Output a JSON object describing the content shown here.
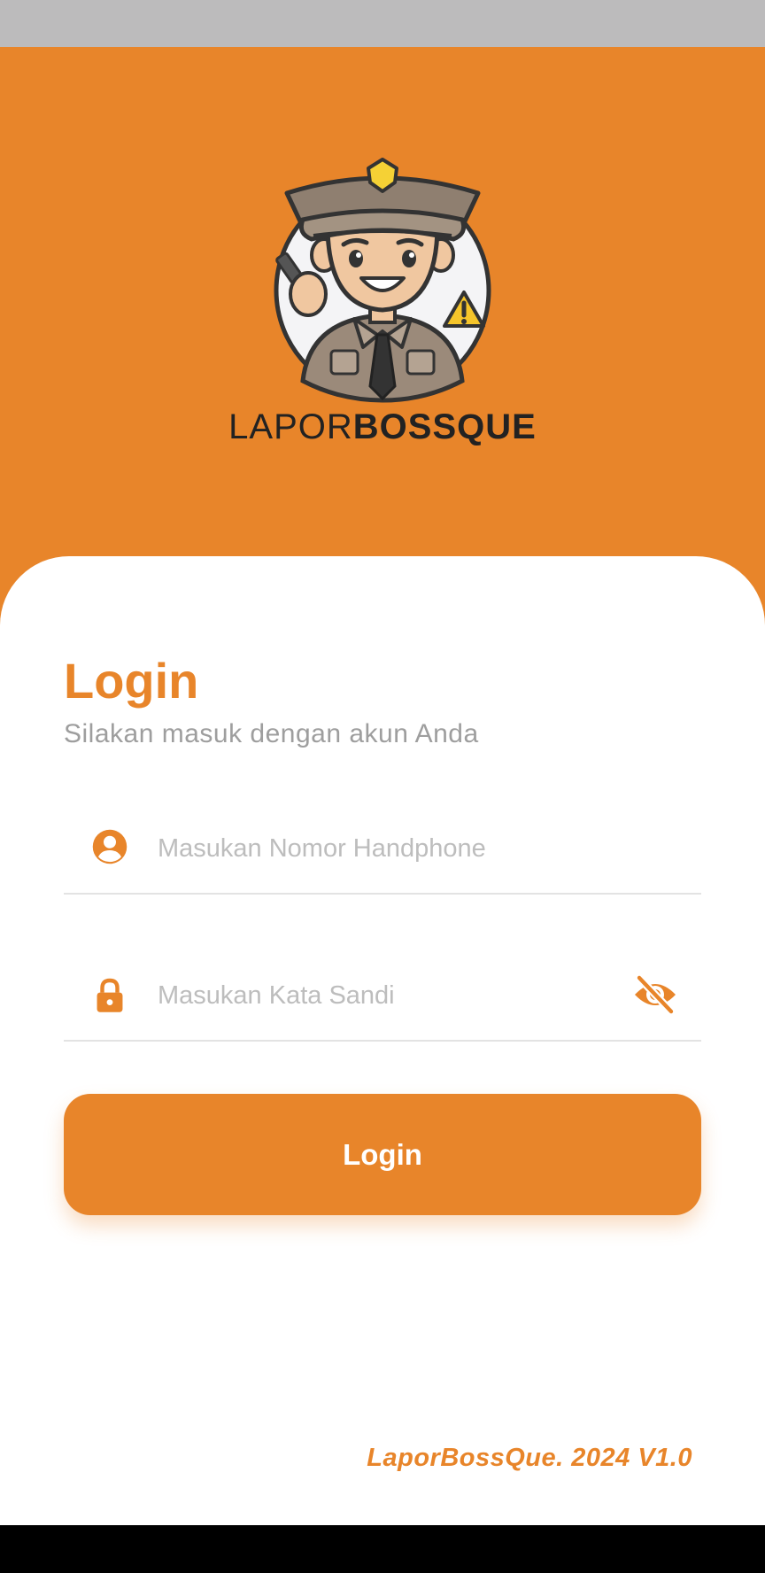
{
  "app": {
    "logo_text_light": "LAPOR",
    "logo_text_bold": "BOSSQUE"
  },
  "login": {
    "title": "Login",
    "subtitle": "Silakan masuk dengan akun Anda",
    "phone_placeholder": "Masukan Nomor Handphone",
    "phone_value": "",
    "password_placeholder": "Masukan Kata Sandi",
    "password_value": "",
    "button_label": "Login"
  },
  "footer": {
    "version": "LaporBossQue. 2024 V1.0"
  },
  "icons": {
    "phone_field": "account-circle-icon",
    "password_field": "lock-icon",
    "password_toggle": "eye-off-icon"
  },
  "colors": {
    "accent": "#e8852a",
    "status_bar": "#bcbbbc",
    "nav_bar": "#000000",
    "placeholder": "#bdbdbd",
    "subtitle": "#9e9e9e"
  }
}
